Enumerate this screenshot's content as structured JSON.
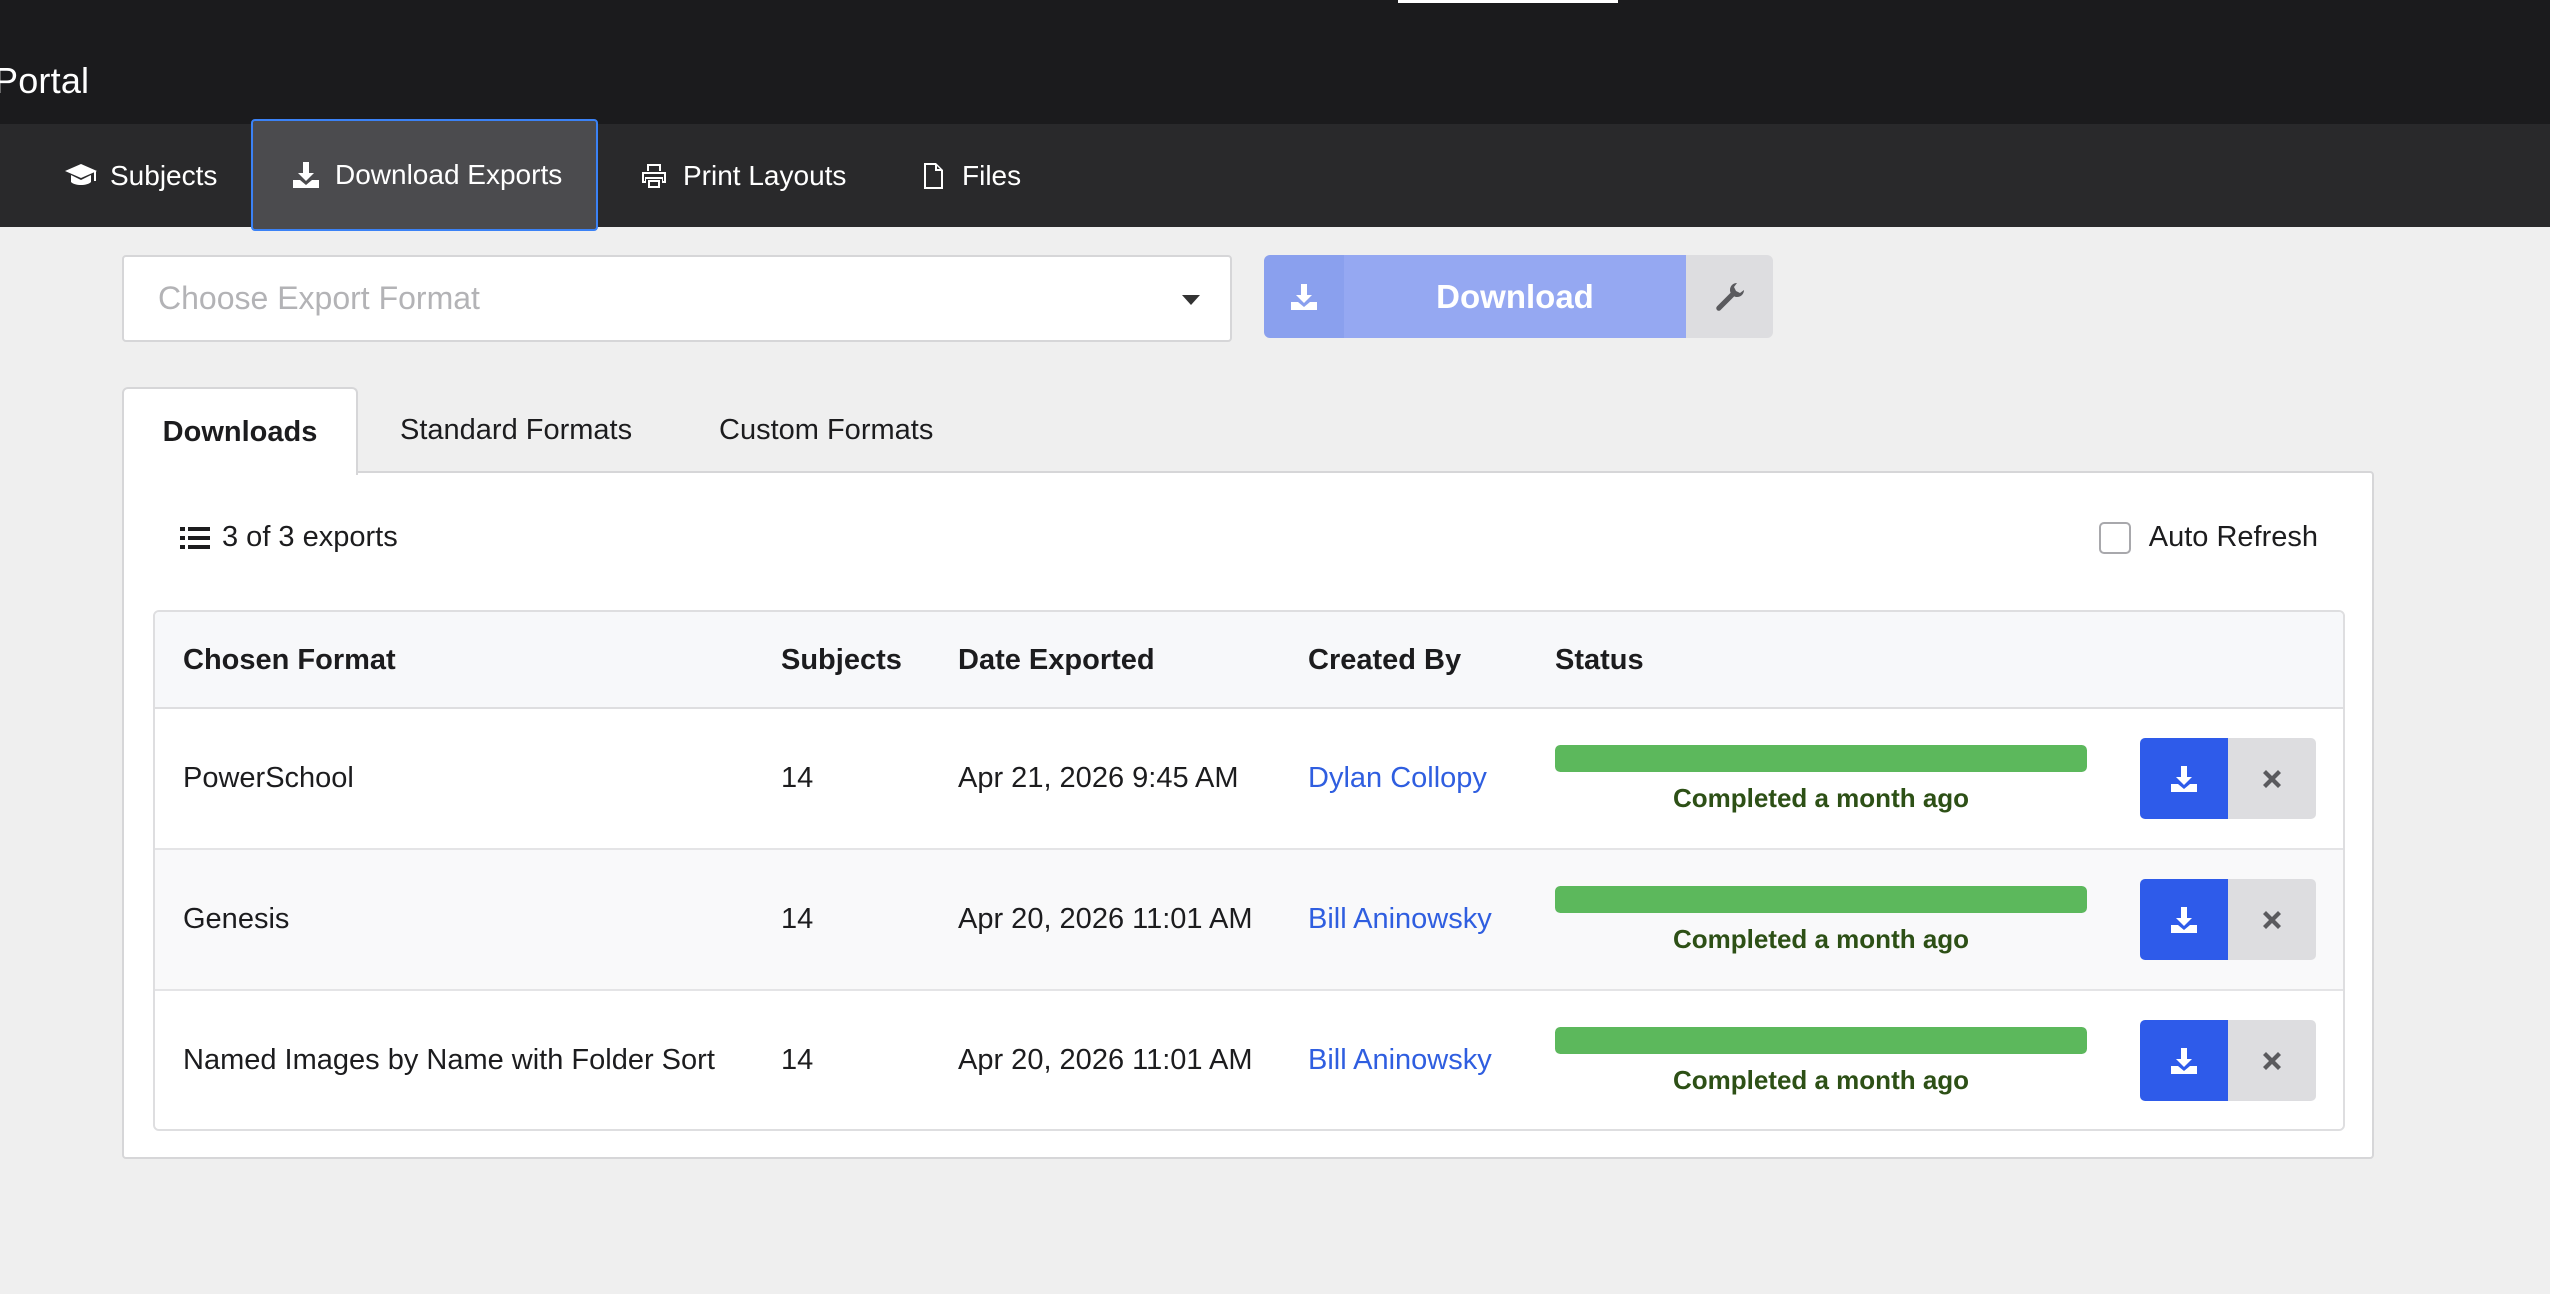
{
  "header": {
    "brand": "Portal"
  },
  "nav": {
    "items": [
      {
        "label": "Subjects",
        "icon": "graduation-cap-icon"
      },
      {
        "label": "Download Exports",
        "icon": "download-icon",
        "active": true
      },
      {
        "label": "Print Layouts",
        "icon": "printer-icon"
      },
      {
        "label": "Files",
        "icon": "file-icon"
      }
    ]
  },
  "toolbar": {
    "format_placeholder": "Choose Export Format",
    "download_label": "Download"
  },
  "tabs": [
    {
      "label": "Downloads",
      "active": true
    },
    {
      "label": "Standard Formats"
    },
    {
      "label": "Custom Formats"
    }
  ],
  "panel": {
    "export_count": "3 of 3 exports",
    "auto_refresh_label": "Auto Refresh",
    "auto_refresh_checked": false
  },
  "table": {
    "headers": [
      "Chosen Format",
      "Subjects",
      "Date Exported",
      "Created By",
      "Status"
    ],
    "rows": [
      {
        "format": "PowerSchool",
        "subjects": "14",
        "date": "Apr 21, 2026 9:45 AM",
        "created_by": "Dylan Collopy",
        "status": "Completed a month ago",
        "progress": 1.0
      },
      {
        "format": "Genesis",
        "subjects": "14",
        "date": "Apr 20, 2026 11:01 AM",
        "created_by": "Bill Aninowsky",
        "status": "Completed a month ago",
        "progress": 1.0
      },
      {
        "format": "Named Images by Name with Folder Sort",
        "subjects": "14",
        "date": "Apr 20, 2026 11:01 AM",
        "created_by": "Bill Aninowsky",
        "status": "Completed a month ago",
        "progress": 1.0
      }
    ]
  },
  "colors": {
    "progress_fill": "#5cb85c",
    "primary": "#2e5bea",
    "link": "#2f5ee0"
  }
}
